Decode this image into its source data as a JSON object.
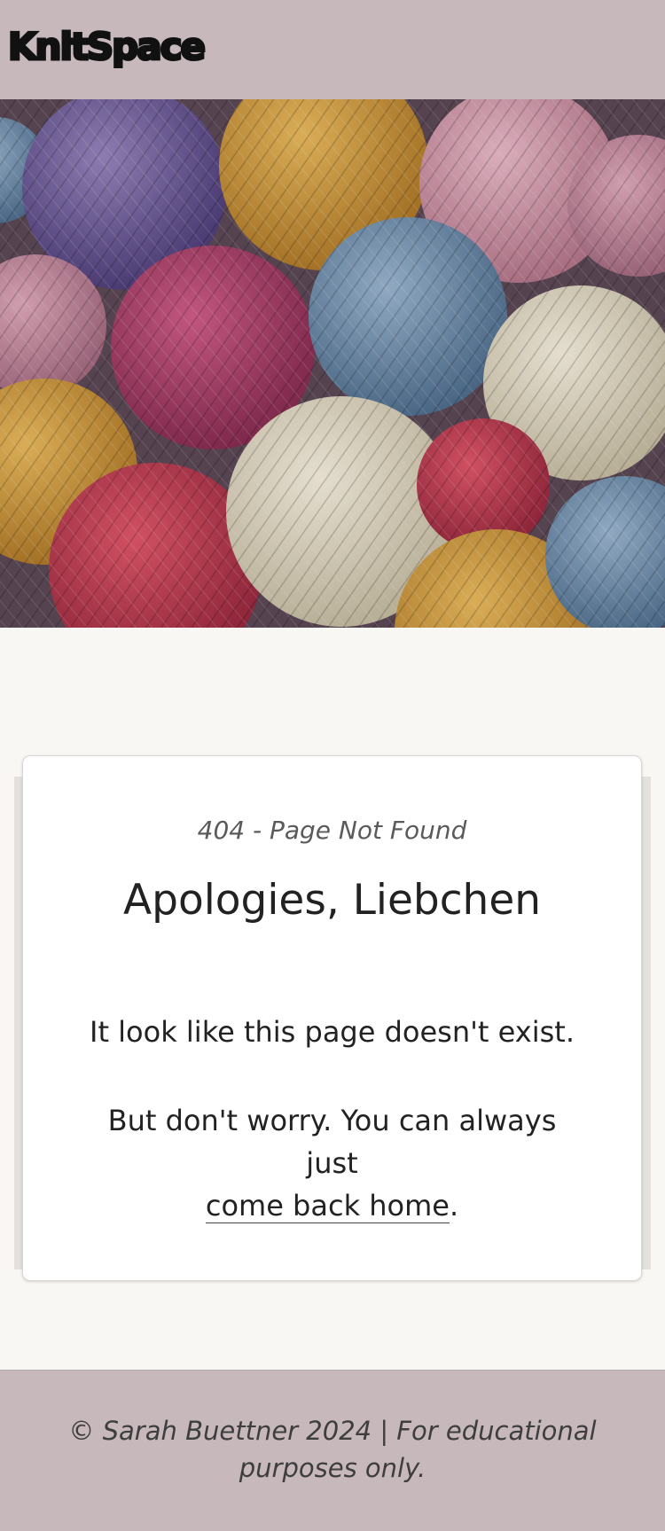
{
  "header": {
    "logo_text": "KnitSpace"
  },
  "hero": {
    "image_description_icon": "yarn-balls-image"
  },
  "card": {
    "subtitle": "404 - Page Not Found",
    "heading": "Apologies, Liebchen",
    "message_line1": "It look like this page doesn't exist.",
    "message_line2_prefix": "But don't worry. You can always just",
    "link_text": "come back home",
    "message_line2_suffix": "."
  },
  "footer": {
    "text": "© Sarah Buettner 2024 | For educational purposes only."
  },
  "colors": {
    "header_bg": "#c7b8bc",
    "page_bg": "#f9f7f4",
    "card_bg": "#ffffff",
    "text": "#222222"
  }
}
